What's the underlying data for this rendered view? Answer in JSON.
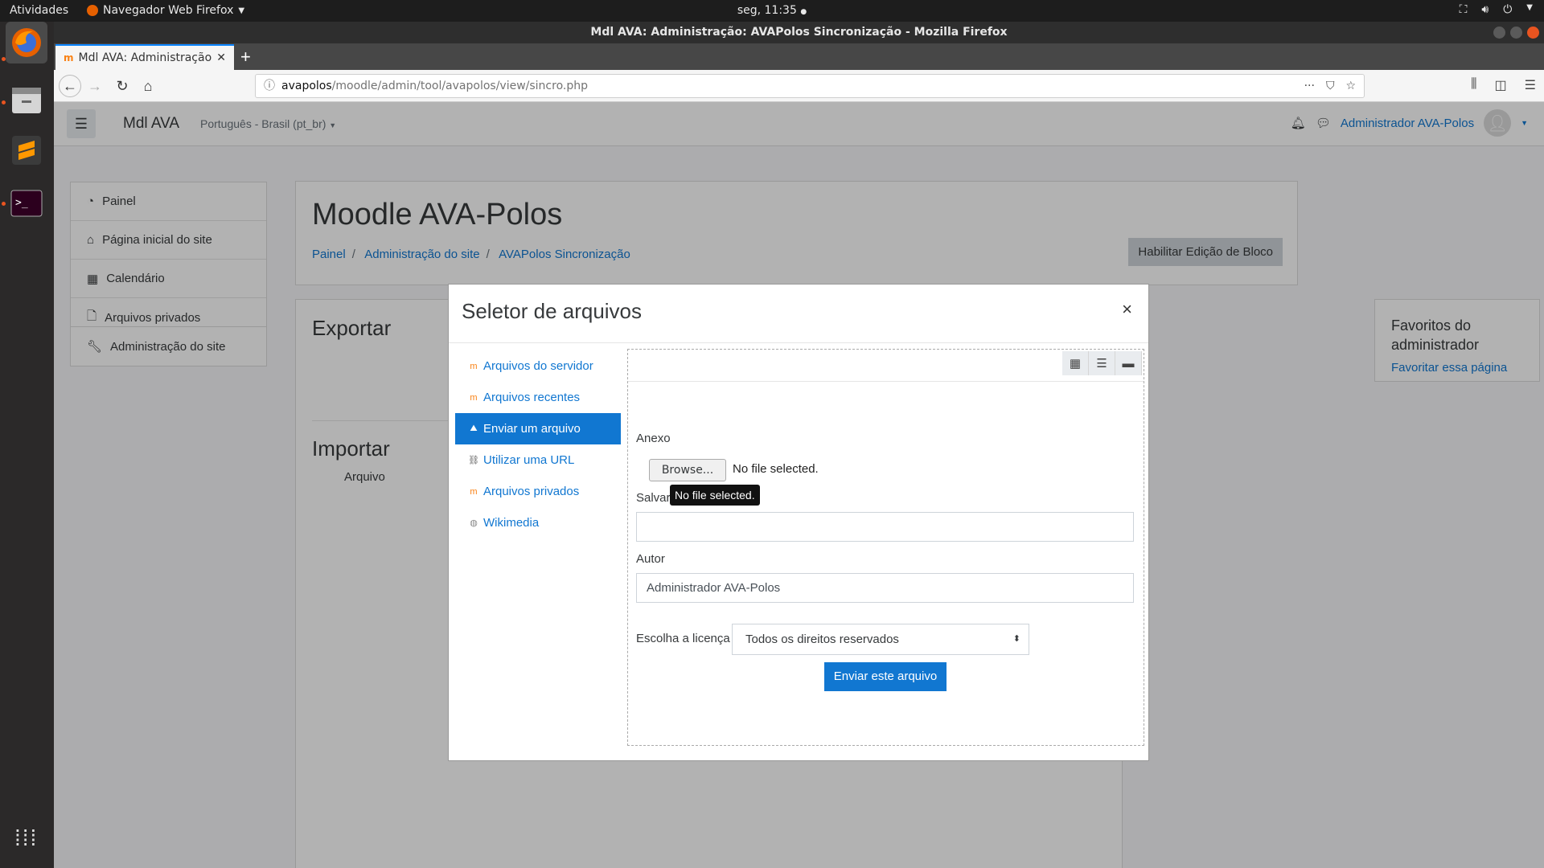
{
  "system": {
    "activities": "Atividades",
    "app_menu": "Navegador Web Firefox",
    "clock": "seg, 11:35",
    "accent": "#e95420"
  },
  "window": {
    "title": "Mdl AVA: Administração: AVAPolos Sincronização - Mozilla Firefox"
  },
  "browser": {
    "tab_title": "Mdl AVA: Administração",
    "url_host": "avapolos",
    "url_path": "/moodle/admin/tool/avapolos/view/sincro.php"
  },
  "moodle": {
    "brand": "Mdl AVA",
    "language": "Português - Brasil (pt_br)",
    "user_name": "Administrador AVA-Polos",
    "nav": [
      "Painel",
      "Página inicial do site",
      "Calendário",
      "Arquivos privados"
    ],
    "admin_nav": "Administração do site",
    "page_title": "Moodle AVA-Polos",
    "breadcrumb": [
      "Painel",
      "Administração do site",
      "AVAPolos Sincronização"
    ],
    "edit_button": "Habilitar Edição de Bloco",
    "export_heading": "Exportar",
    "import_heading": "Importar",
    "import_label": "Arquivo",
    "favorites": {
      "title": "Favoritos do administrador",
      "link": "Favoritar essa página"
    },
    "link_color": "#1177d1"
  },
  "modal": {
    "title": "Seletor de arquivos",
    "close": "×",
    "repositories": [
      {
        "label": "Arquivos do servidor",
        "icon": "moodle-icon"
      },
      {
        "label": "Arquivos recentes",
        "icon": "moodle-icon"
      },
      {
        "label": "Enviar um arquivo",
        "icon": "upload-icon",
        "active": true
      },
      {
        "label": "Utilizar uma URL",
        "icon": "url-icon"
      },
      {
        "label": "Arquivos privados",
        "icon": "moodle-icon"
      },
      {
        "label": "Wikimedia",
        "icon": "wikimedia-icon"
      }
    ],
    "attachment_label": "Anexo",
    "browse_button": "Browse...",
    "no_file": "No file selected.",
    "tooltip": "No file selected.",
    "save_as_label": "Salvar como",
    "save_as_value": "",
    "author_label": "Autor",
    "author_value": "Administrador AVA-Polos",
    "license_label": "Escolha a licença",
    "license_value": "Todos os direitos reservados",
    "submit_button": "Enviar este arquivo"
  }
}
